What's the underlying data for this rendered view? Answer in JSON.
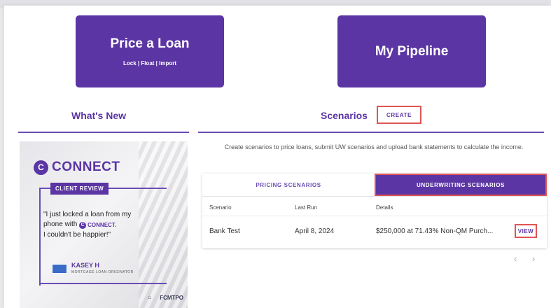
{
  "buttons": {
    "price_loan": {
      "label": "Price a Loan",
      "sub": "Lock | Float | Import"
    },
    "pipeline": {
      "label": "My Pipeline"
    }
  },
  "whats_new": {
    "title": "What's New",
    "promo": {
      "logo_letter": "C",
      "logo_text": "CONNECT",
      "badge": "CLIENT REVIEW",
      "quote_line1": "\"I just locked a loan from my",
      "quote_line2_prefix": "phone with",
      "quote_inline_brand": "CONNECT.",
      "quote_line3": "I couldn't be happier!\"",
      "person_name": "KASEY H",
      "person_role": "MORTGAGE LOAN ORIGINATOR",
      "brand": "FCMTPO"
    }
  },
  "scenarios": {
    "title": "Scenarios",
    "create_label": "CREATE",
    "description": "Create scenarios to price loans, submit UW scenarios and upload bank statements to calculate the income.",
    "tabs": [
      {
        "label": "PRICING SCENARIOS",
        "active": false
      },
      {
        "label": "UNDERWRITING SCENARIOS",
        "active": true
      }
    ],
    "table": {
      "headers": [
        "Scenario",
        "Last Run",
        "Details"
      ],
      "rows": [
        {
          "scenario": "Bank Test",
          "last_run": "April 8, 2024",
          "details": "$250,000 at 71.43% Non-QM Purch...",
          "action": "VIEW"
        }
      ]
    },
    "pager": {
      "prev": "‹",
      "next": "›"
    }
  },
  "colors": {
    "brand": "#5b35a4",
    "highlight": "#e05555"
  }
}
